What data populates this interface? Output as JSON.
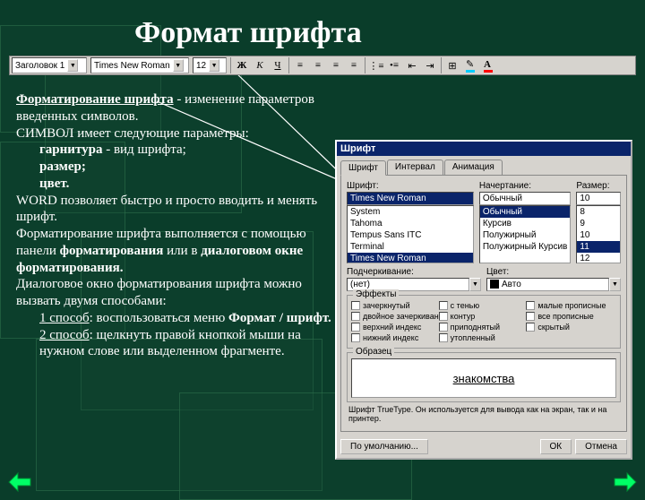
{
  "slide": {
    "title": "Формат шрифта"
  },
  "toolbar": {
    "style_combo": "Заголовок 1",
    "font_combo": "Times New Roman",
    "size_combo": "12",
    "bold": "Ж",
    "italic": "К",
    "underline": "Ч"
  },
  "text": {
    "p1a": "Форматирование шрифта",
    "p1b": " - изменение параметров введенных символов.",
    "p2": "СИМВОЛ имеет следующие параметры:",
    "li1a": "гарнитура",
    "li1b": " - вид шрифта;",
    "li2": "размер;",
    "li3": "цвет.",
    "p3": "WORD позволяет быстро и просто вводить и менять шрифт.",
    "p4a": "Форматирование шрифта выполняется с помощью панели ",
    "p4b": "форматирования",
    "p4c": " или в ",
    "p4d": "диалоговом окне форматирования.",
    "p5": " Диалоговое окно форматирования шрифта можно вызвать двумя способами:",
    "m1a": "1 способ",
    "m1b": ": воспользоваться меню ",
    "m1c": "Формат / шрифт.",
    "m2a": "2 способ",
    "m2b": ": щелкнуть правой кнопкой мыши на нужном слове или выделенном фрагменте."
  },
  "dialog": {
    "title": "Шрифт",
    "tabs": {
      "t1": "Шрифт",
      "t2": "Интервал",
      "t3": "Анимация"
    },
    "labels": {
      "font": "Шрифт:",
      "style": "Начертание:",
      "size": "Размер:",
      "underline": "Подчеркивание:",
      "color": "Цвет:",
      "effects": "Эффекты",
      "preview": "Образец"
    },
    "font_value": "Times New Roman",
    "font_list": [
      "System",
      "Tahoma",
      "Tempus Sans ITC",
      "Terminal",
      "Times New Roman"
    ],
    "style_value": "Обычный",
    "style_list": [
      "Обычный",
      "Курсив",
      "Полужирный",
      "Полужирный Курсив"
    ],
    "size_value": "10",
    "size_list": [
      "8",
      "9",
      "10",
      "11",
      "12"
    ],
    "underline_value": "(нет)",
    "color_value": "Авто",
    "effects": {
      "e1": "зачеркнутый",
      "e2": "с тенью",
      "e3": "малые прописные",
      "e4": "двойное зачеркивание",
      "e5": "контур",
      "e6": "все прописные",
      "e7": "верхний индекс",
      "e8": "приподнятый",
      "e9": "скрытый",
      "e10": "нижний индекс",
      "e11": "утопленный"
    },
    "preview_text": "знакомства",
    "note": "Шрифт TrueType. Он используется для вывода как на экран, так и на принтер.",
    "buttons": {
      "default": "По умолчанию...",
      "ok": "ОК",
      "cancel": "Отмена"
    }
  }
}
